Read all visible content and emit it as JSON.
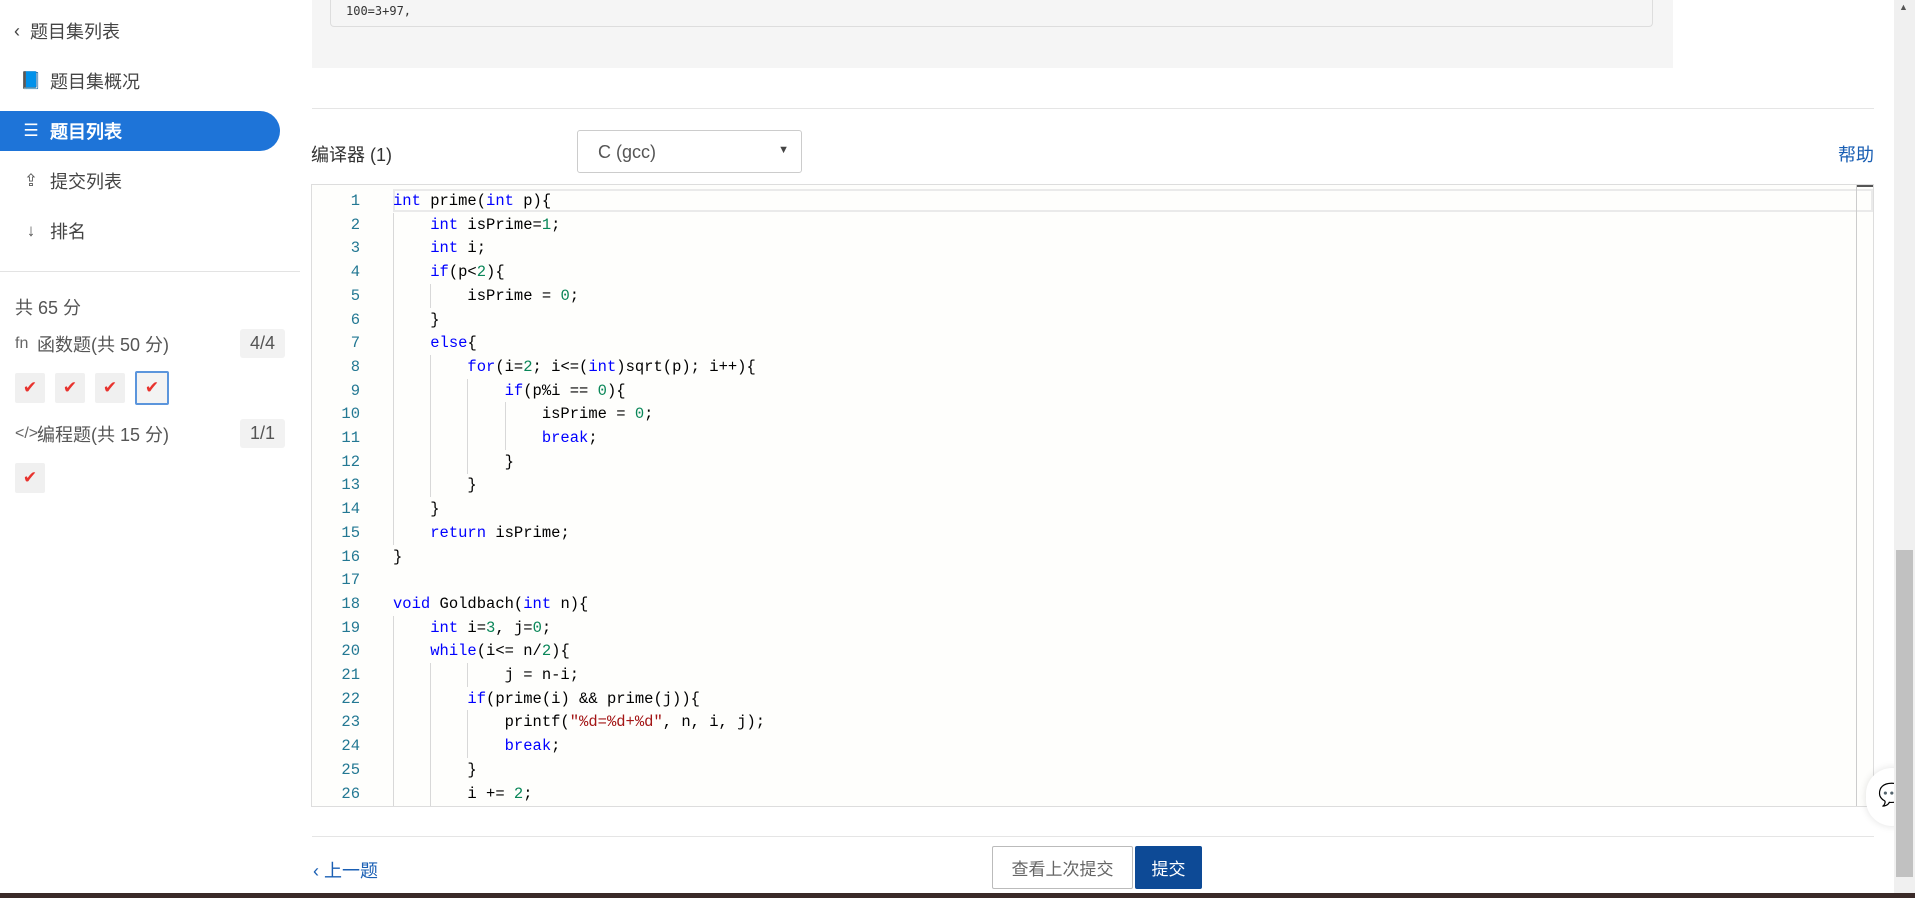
{
  "sidebar": {
    "back_label": "题目集列表",
    "items": [
      {
        "label": "题目集概况",
        "icon": "book-icon"
      },
      {
        "label": "题目列表",
        "icon": "list-icon",
        "active": true
      },
      {
        "label": "提交列表",
        "icon": "upload-icon"
      },
      {
        "label": "排名",
        "icon": "sort-numeric-icon"
      }
    ],
    "total": "共 65 分",
    "categories": [
      {
        "icon": "fn",
        "label": "函数题(共 50 分)",
        "count": "4/4",
        "solved": 4
      },
      {
        "icon": "</>",
        "label": "编程题(共 15 分)",
        "count": "1/1",
        "solved": 1
      }
    ]
  },
  "sample_output": "100=3+97,",
  "compiler": {
    "label": "编译器 (1)",
    "selected": "C (gcc)",
    "help": "帮助"
  },
  "code_lines": [
    [
      [
        "kw",
        "int"
      ],
      [
        "id",
        " prime("
      ],
      [
        "kw",
        "int"
      ],
      [
        "id",
        " p){"
      ]
    ],
    [
      [
        "id",
        "    "
      ],
      [
        "kw",
        "int"
      ],
      [
        "id",
        " isPrime="
      ],
      [
        "num",
        "1"
      ],
      [
        "id",
        ";"
      ]
    ],
    [
      [
        "id",
        "    "
      ],
      [
        "kw",
        "int"
      ],
      [
        "id",
        " i;"
      ]
    ],
    [
      [
        "id",
        "    "
      ],
      [
        "kw",
        "if"
      ],
      [
        "id",
        "(p<"
      ],
      [
        "num",
        "2"
      ],
      [
        "id",
        "){"
      ]
    ],
    [
      [
        "id",
        "        isPrime = "
      ],
      [
        "num",
        "0"
      ],
      [
        "id",
        ";"
      ]
    ],
    [
      [
        "id",
        "    }"
      ]
    ],
    [
      [
        "id",
        "    "
      ],
      [
        "kw",
        "else"
      ],
      [
        "id",
        "{"
      ]
    ],
    [
      [
        "id",
        "        "
      ],
      [
        "kw",
        "for"
      ],
      [
        "id",
        "(i="
      ],
      [
        "num",
        "2"
      ],
      [
        "id",
        "; i<=("
      ],
      [
        "kw",
        "int"
      ],
      [
        "id",
        ")sqrt(p); i++){"
      ]
    ],
    [
      [
        "id",
        "            "
      ],
      [
        "kw",
        "if"
      ],
      [
        "id",
        "(p%i == "
      ],
      [
        "num",
        "0"
      ],
      [
        "id",
        "){"
      ]
    ],
    [
      [
        "id",
        "                isPrime = "
      ],
      [
        "num",
        "0"
      ],
      [
        "id",
        ";"
      ]
    ],
    [
      [
        "id",
        "                "
      ],
      [
        "kw",
        "break"
      ],
      [
        "id",
        ";"
      ]
    ],
    [
      [
        "id",
        "            }"
      ]
    ],
    [
      [
        "id",
        "        }"
      ]
    ],
    [
      [
        "id",
        "    }"
      ]
    ],
    [
      [
        "id",
        "    "
      ],
      [
        "kw",
        "return"
      ],
      [
        "id",
        " isPrime;"
      ]
    ],
    [
      [
        "id",
        "}"
      ]
    ],
    [],
    [
      [
        "kw",
        "void"
      ],
      [
        "id",
        " Goldbach("
      ],
      [
        "kw",
        "int"
      ],
      [
        "id",
        " n){"
      ]
    ],
    [
      [
        "id",
        "    "
      ],
      [
        "kw",
        "int"
      ],
      [
        "id",
        " i="
      ],
      [
        "num",
        "3"
      ],
      [
        "id",
        ", j="
      ],
      [
        "num",
        "0"
      ],
      [
        "id",
        ";"
      ]
    ],
    [
      [
        "id",
        "    "
      ],
      [
        "kw",
        "while"
      ],
      [
        "id",
        "(i<= n/"
      ],
      [
        "num",
        "2"
      ],
      [
        "id",
        "){"
      ]
    ],
    [
      [
        "id",
        "            j = n-i;"
      ]
    ],
    [
      [
        "id",
        "        "
      ],
      [
        "kw",
        "if"
      ],
      [
        "id",
        "(prime(i) && prime(j)){"
      ]
    ],
    [
      [
        "id",
        "            printf("
      ],
      [
        "str",
        "\"%d=%d+%d\""
      ],
      [
        "id",
        ", n, i, j);"
      ]
    ],
    [
      [
        "id",
        "            "
      ],
      [
        "kw",
        "break"
      ],
      [
        "id",
        ";"
      ]
    ],
    [
      [
        "id",
        "        }"
      ]
    ],
    [
      [
        "id",
        "        i += "
      ],
      [
        "num",
        "2"
      ],
      [
        "id",
        ";"
      ]
    ]
  ],
  "footer": {
    "prev": "上一题",
    "view_last": "查看上次提交",
    "submit": "提交"
  },
  "colors": {
    "accent": "#1e74d8",
    "submit": "#0d4a96",
    "keyword": "#0000ff",
    "number": "#098658",
    "string": "#a31515",
    "line_number": "#237893",
    "check": "#e8332e"
  }
}
